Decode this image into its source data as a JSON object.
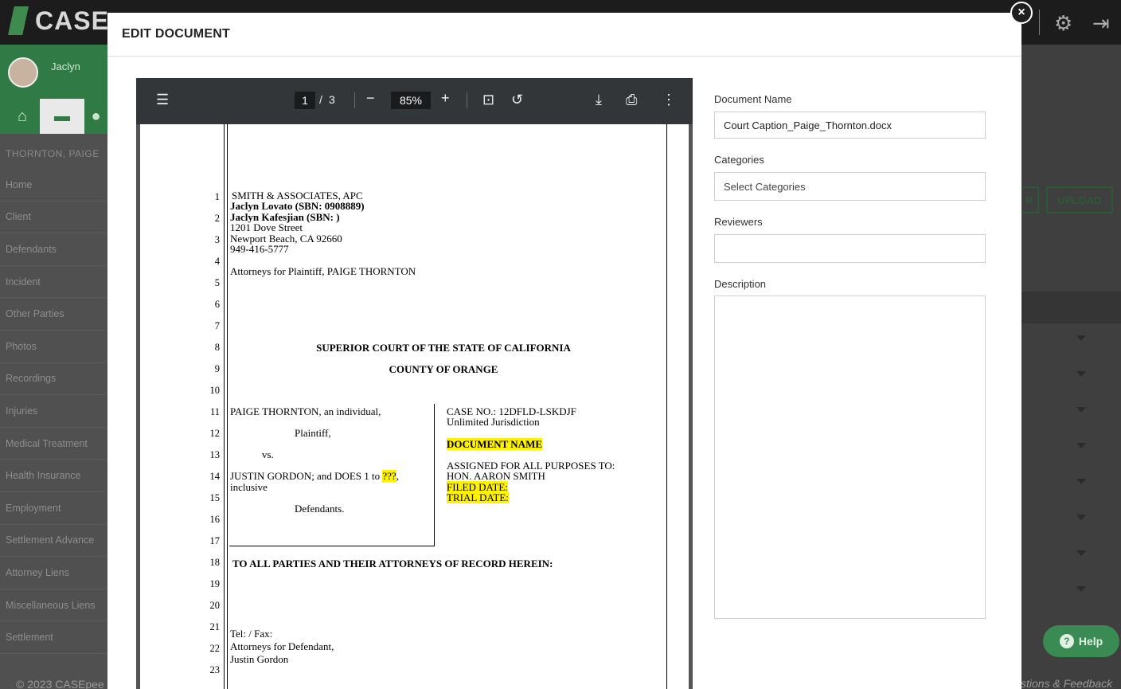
{
  "app": {
    "logo_text": "CASE",
    "user_name": "Jaclyn",
    "case_name": "THORNTON, PAIGE",
    "sidebar_items": [
      "Home",
      "Client",
      "Defendants",
      "Incident",
      "Other Parties",
      "Photos",
      "Recordings",
      "Injuries",
      "Medical Treatment",
      "Health Insurance",
      "Employment",
      "Settlement Advance",
      "Attorney Liens",
      "Miscellaneous Liens",
      "Settlement"
    ],
    "footer_copyright": "© 2023 CASEpee",
    "footer_feedback": "stions & Feedback",
    "upload_label": "UPLOAD",
    "partial_button_label": "R",
    "help_label": "Help",
    "icons": [
      "home-icon",
      "folder-icon",
      "people-icon",
      "gear-icon",
      "logout-icon"
    ]
  },
  "modal": {
    "title": "EDIT DOCUMENT",
    "close_glyph": "×"
  },
  "pdf_viewer": {
    "current_page": "1",
    "separator": "/",
    "total_pages": "3",
    "zoom": "85%",
    "icons": [
      "menu-icon",
      "zoom-out-icon",
      "zoom-in-icon",
      "fit-page-icon",
      "rotate-icon",
      "download-icon",
      "print-icon",
      "more-icon"
    ],
    "document": {
      "line_numbers": [
        "1",
        "2",
        "3",
        "4",
        "5",
        "6",
        "7",
        "8",
        "9",
        "10",
        "11",
        "12",
        "13",
        "14",
        "15",
        "16",
        "17",
        "18",
        "19",
        "20",
        "21",
        "22",
        "23"
      ],
      "firm_name": "SMITH & ASSOCIATES, APC",
      "attorney_1": "Jaclyn Lovato (SBN: 0908889)",
      "attorney_2": "Jaclyn Kafesjian (SBN: )",
      "street": "1201 Dove Street",
      "city": "Newport Beach, CA 92660",
      "phone": "949-416-5777",
      "attorneys_for": "Attorneys for Plaintiff, PAIGE THORNTON",
      "court": "SUPERIOR COURT OF THE STATE OF CALIFORNIA",
      "county": "COUNTY OF ORANGE",
      "plaintiff": "PAIGE  THORNTON, an individual,",
      "plaintiff_role": "Plaintiff,",
      "vs": "vs.",
      "defendant_prefix": "JUSTIN GORDON;  and DOES 1 to ",
      "defendant_placeholder": "???",
      "defendant_suffix": ",",
      "inclusive": "inclusive",
      "defendant_role": "Defendants.",
      "case_no": "CASE NO.: 12DFLD-LSKDJF",
      "jurisdiction": "Unlimited Jurisdiction",
      "document_name_placeholder": "DOCUMENT NAME",
      "assigned": "ASSIGNED FOR ALL PURPOSES TO:",
      "judge": "HON. AARON  SMITH",
      "filed_date": "FILED DATE:",
      "trial_date": "TRIAL DATE:",
      "to_all_parties": "TO ALL PARTIES AND THEIR ATTORNEYS OF RECORD HEREIN:",
      "tel_fax": "Tel:  / Fax:",
      "attorneys_for_defendant": "Attorneys for Defendant,",
      "defendant_name": "Justin Gordon"
    }
  },
  "form": {
    "document_name_label": "Document Name",
    "document_name_value": "Court Caption_Paige_Thornton.docx",
    "categories_label": "Categories",
    "categories_placeholder": "Select Categories",
    "reviewers_label": "Reviewers",
    "reviewers_value": "",
    "description_label": "Description",
    "description_value": ""
  },
  "colors": {
    "brand_green": "#2f7a45",
    "help_green": "#3a8a53",
    "highlight_yellow": "#fff200",
    "pdf_toolbar": "#323639"
  }
}
